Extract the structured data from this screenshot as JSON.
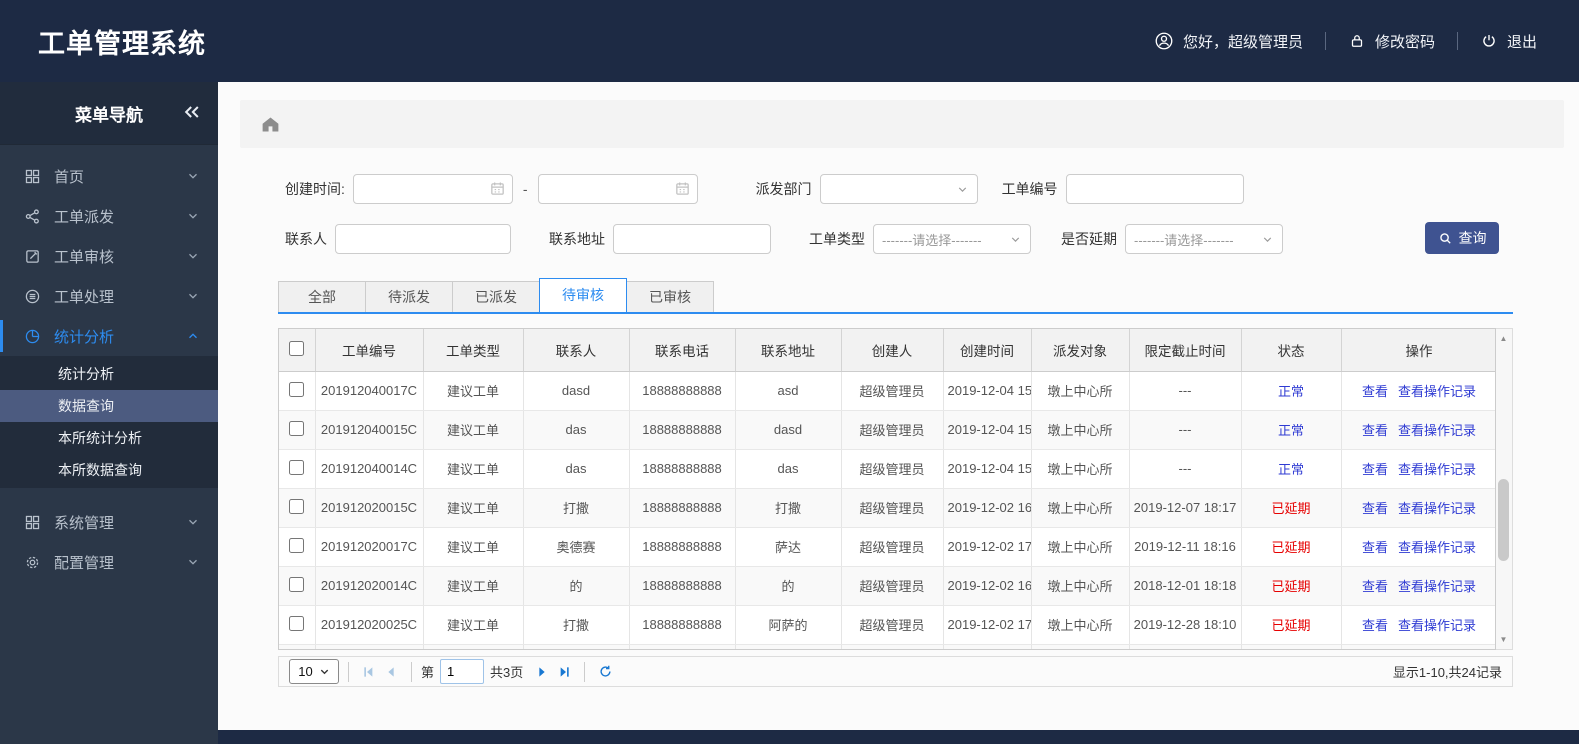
{
  "colors": {
    "accent": "#2d8cf0",
    "header_bg": "#1d2a44",
    "sidebar_bg": "#2b3748",
    "submenu_selected": "#4c5b80",
    "btn": "#3f5391",
    "link": "#2f3bd3",
    "delayed": "#e60000"
  },
  "header": {
    "title": "工单管理系统",
    "greeting": "您好，超级管理员",
    "change_password": "修改密码",
    "logout": "退出"
  },
  "sidebar": {
    "title": "菜单导航",
    "items": [
      {
        "label": "首页"
      },
      {
        "label": "工单派发"
      },
      {
        "label": "工单审核"
      },
      {
        "label": "工单处理"
      },
      {
        "label": "统计分析",
        "active": true,
        "children": [
          {
            "label": "统计分析"
          },
          {
            "label": "数据查询",
            "selected": true
          },
          {
            "label": "本所统计分析"
          },
          {
            "label": "本所数据查询"
          }
        ]
      },
      {
        "label": "系统管理"
      },
      {
        "label": "配置管理"
      }
    ]
  },
  "filters": {
    "created_time_label": "创建时间:",
    "range_separator": "-",
    "dispatch_dept_label": "派发部门",
    "order_no_label": "工单编号",
    "contact_label": "联系人",
    "address_label": "联系地址",
    "order_type_label": "工单类型",
    "delay_label": "是否延期",
    "select_placeholder": "-------请选择-------",
    "search_button": "查询"
  },
  "tabs": [
    {
      "label": "全部"
    },
    {
      "label": "待派发"
    },
    {
      "label": "已派发"
    },
    {
      "label": "待审核",
      "active": true
    },
    {
      "label": "已审核"
    }
  ],
  "table": {
    "columns": [
      "工单编号",
      "工单类型",
      "联系人",
      "联系电话",
      "联系地址",
      "创建人",
      "创建时间",
      "派发对象",
      "限定截止时间",
      "状态",
      "操作"
    ],
    "action_labels": [
      "查看",
      "查看操作记录"
    ],
    "rows": [
      {
        "id": "201912040017C",
        "type": "建议工单",
        "contact": "dasd",
        "phone": "18888888888",
        "address": "asd",
        "creator": "超级管理员",
        "created": "2019-12-04 15",
        "target": "墩上中心所",
        "deadline": "---",
        "status": "正常",
        "delayed": false
      },
      {
        "id": "201912040015C",
        "type": "建议工单",
        "contact": "das",
        "phone": "18888888888",
        "address": "dasd",
        "creator": "超级管理员",
        "created": "2019-12-04 15",
        "target": "墩上中心所",
        "deadline": "---",
        "status": "正常",
        "delayed": false
      },
      {
        "id": "201912040014C",
        "type": "建议工单",
        "contact": "das",
        "phone": "18888888888",
        "address": "das",
        "creator": "超级管理员",
        "created": "2019-12-04 15",
        "target": "墩上中心所",
        "deadline": "---",
        "status": "正常",
        "delayed": false
      },
      {
        "id": "201912020015C",
        "type": "建议工单",
        "contact": "打撒",
        "phone": "18888888888",
        "address": "打撒",
        "creator": "超级管理员",
        "created": "2019-12-02 16",
        "target": "墩上中心所",
        "deadline": "2019-12-07 18:17",
        "status": "已延期",
        "delayed": true
      },
      {
        "id": "201912020017C",
        "type": "建议工单",
        "contact": "奥德赛",
        "phone": "18888888888",
        "address": "萨达",
        "creator": "超级管理员",
        "created": "2019-12-02 17",
        "target": "墩上中心所",
        "deadline": "2019-12-11 18:16",
        "status": "已延期",
        "delayed": true
      },
      {
        "id": "201912020014C",
        "type": "建议工单",
        "contact": "的",
        "phone": "18888888888",
        "address": "的",
        "creator": "超级管理员",
        "created": "2019-12-02 16",
        "target": "墩上中心所",
        "deadline": "2018-12-01 18:18",
        "status": "已延期",
        "delayed": true
      },
      {
        "id": "201912020025C",
        "type": "建议工单",
        "contact": "打撒",
        "phone": "18888888888",
        "address": "阿萨的",
        "creator": "超级管理员",
        "created": "2019-12-02 17",
        "target": "墩上中心所",
        "deadline": "2019-12-28 18:10",
        "status": "已延期",
        "delayed": true
      }
    ]
  },
  "pagination": {
    "page_size": "10",
    "page_prefix": "第",
    "current_page": "1",
    "total_pages_text": "共3页",
    "summary": "显示1-10,共24记录"
  }
}
